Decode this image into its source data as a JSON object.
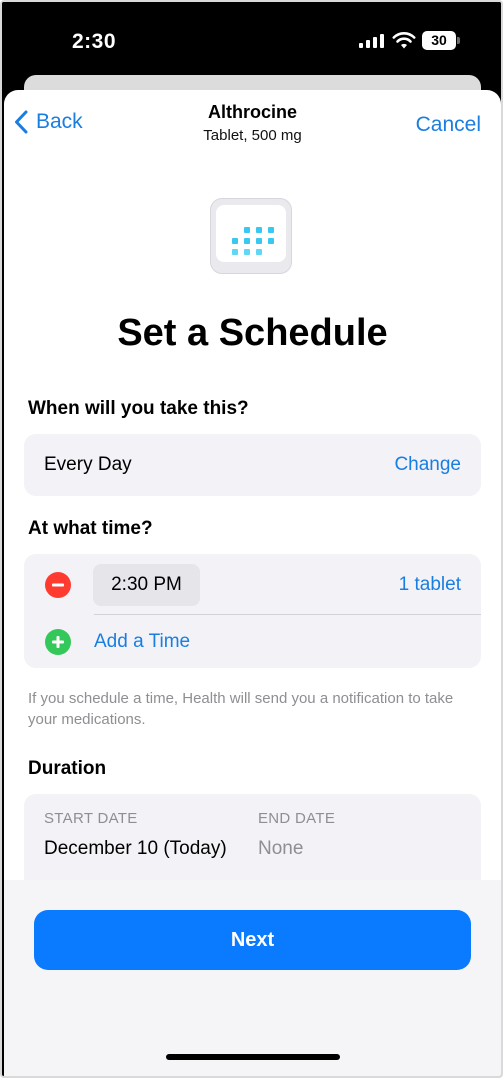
{
  "status_bar": {
    "time": "2:30",
    "battery": "30",
    "icons": [
      "cellular-signal-icon",
      "wifi-icon",
      "battery-icon"
    ]
  },
  "nav": {
    "back_label": "Back",
    "title": "Althrocine",
    "subtitle": "Tablet, 500 mg",
    "cancel_label": "Cancel"
  },
  "page": {
    "icon": "calendar-icon",
    "heading": "Set a Schedule"
  },
  "frequency": {
    "label": "When will you take this?",
    "value": "Every Day",
    "change_label": "Change"
  },
  "times": {
    "label": "At what time?",
    "entries": [
      {
        "time": "2:30 PM",
        "dose": "1 tablet"
      }
    ],
    "add_label": "Add a Time",
    "note": "If you schedule a time, Health will send you a notification to take your medications."
  },
  "duration": {
    "label": "Duration",
    "start_label": "START DATE",
    "start_value": "December 10 (Today)",
    "end_label": "END DATE",
    "end_value": "None"
  },
  "footer": {
    "next_label": "Next"
  },
  "colors": {
    "accent": "#1a7ee0",
    "button": "#0a7aff",
    "remove": "#ff3b30",
    "add": "#34c759",
    "group_bg": "#f2f2f7",
    "calendar_dots": "#38c8f0"
  }
}
